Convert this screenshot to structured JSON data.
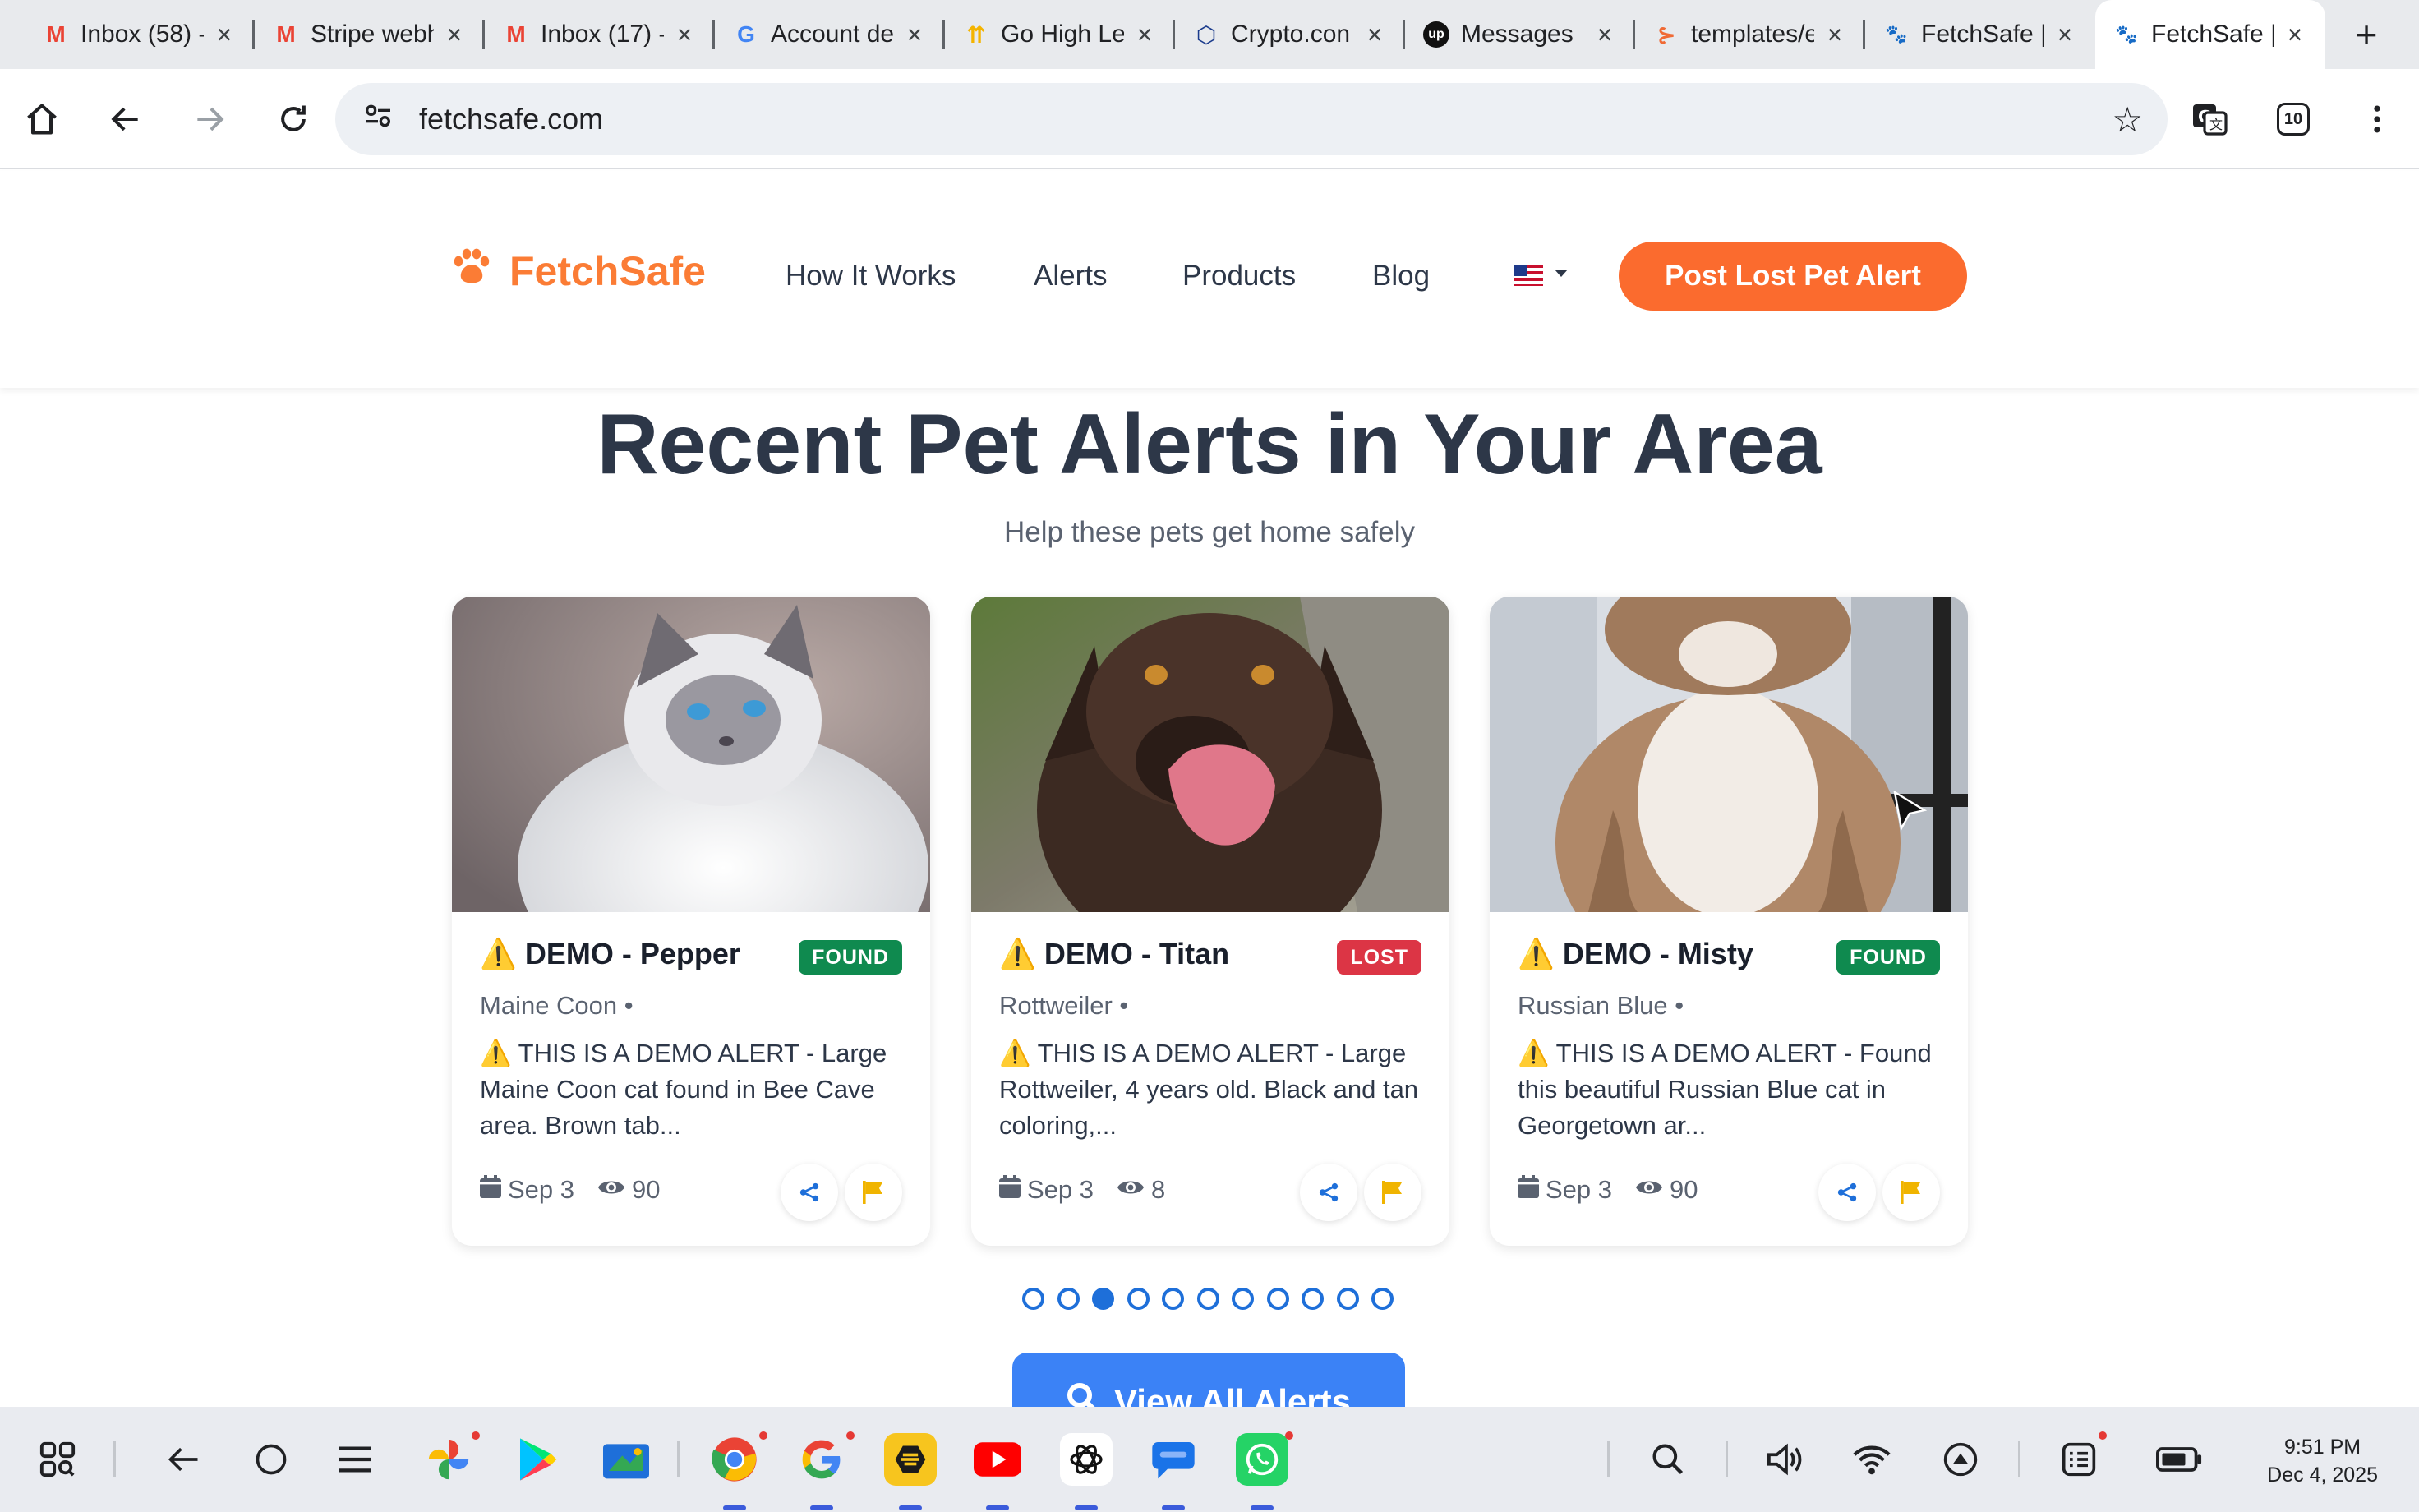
{
  "browser": {
    "tabs": [
      {
        "label": "Inbox (58) -",
        "favicon": "gmail-icon",
        "glyph": "M",
        "color": "#ea4335"
      },
      {
        "label": "Stripe webh",
        "favicon": "gmail-icon",
        "glyph": "M",
        "color": "#ea4335"
      },
      {
        "label": "Inbox (17) -",
        "favicon": "gmail-icon",
        "glyph": "M",
        "color": "#ea4335"
      },
      {
        "label": "Account de",
        "favicon": "google-icon",
        "glyph": "G",
        "color": "#4285f4"
      },
      {
        "label": "Go High Le",
        "favicon": "gohighlevel-icon",
        "glyph": "⇈",
        "color": "#f4b400"
      },
      {
        "label": "Crypto.con",
        "favicon": "crypto-icon",
        "glyph": "⬡",
        "color": "#1a3b8c"
      },
      {
        "label": "Messages",
        "favicon": "upwork-icon",
        "glyph": "up",
        "color": "#111111"
      },
      {
        "label": "templates/e",
        "favicon": "templates-icon",
        "glyph": "⊱",
        "color": "#f06a35"
      },
      {
        "label": "FetchSafe |",
        "favicon": "fetchsafe-icon",
        "glyph": "🐾",
        "color": "#fb7c35"
      },
      {
        "label": "FetchSafe |",
        "favicon": "fetchsafe-icon",
        "glyph": "🐾",
        "color": "#fb7c35"
      }
    ],
    "url": "fetchsafe.com",
    "extension_badge": "10"
  },
  "site": {
    "brand": "FetchSafe",
    "nav": [
      "How It Works",
      "Alerts",
      "Products",
      "Blog"
    ],
    "cta": "Post Lost Pet Alert",
    "accent": "#fb6b2e"
  },
  "section": {
    "title": "Recent Pet Alerts in Your Area",
    "subtitle": "Help these pets get home safely"
  },
  "cards": [
    {
      "name": "⚠️ DEMO - Pepper",
      "status": "FOUND",
      "status_color": "#0f8a4f",
      "breed": "Maine Coon •",
      "description": "⚠️ THIS IS A DEMO ALERT - Large Maine Coon cat found in Bee Cave area. Brown tab...",
      "date": "Sep 3",
      "views": "90"
    },
    {
      "name": "⚠️ DEMO - Titan",
      "status": "LOST",
      "status_color": "#dc3545",
      "breed": "Rottweiler •",
      "description": "⚠️ THIS IS A DEMO ALERT - Large Rottweiler, 4 years old. Black and tan coloring,...",
      "date": "Sep 3",
      "views": "8"
    },
    {
      "name": "⚠️ DEMO - Misty",
      "status": "FOUND",
      "status_color": "#0f8a4f",
      "breed": "Russian Blue •",
      "description": "⚠️ THIS IS A DEMO ALERT - Found this beautiful Russian Blue cat in Georgetown ar...",
      "date": "Sep 3",
      "views": "90"
    }
  ],
  "carousel": {
    "total": 11,
    "active": 3
  },
  "view_all": "View All Alerts",
  "taskbar": {
    "time": "9:51 PM",
    "date": "Dec 4, 2025"
  }
}
